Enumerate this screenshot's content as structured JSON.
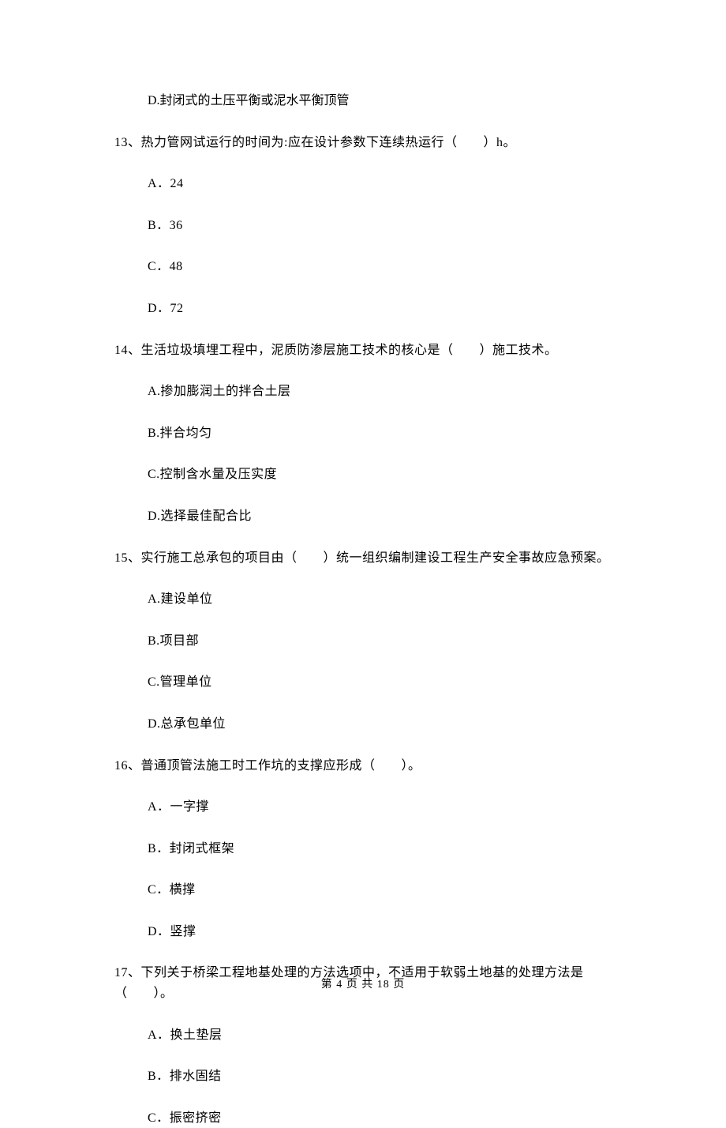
{
  "orphan_option": "D.封闭式的土压平衡或泥水平衡顶管",
  "questions": [
    {
      "number": "13、",
      "text": "热力管网试运行的时间为:应在设计参数下连续热运行（　　）h。",
      "options": [
        "A．24",
        "B．36",
        "C．48",
        "D．72"
      ]
    },
    {
      "number": "14、",
      "text": "生活垃圾填埋工程中，泥质防渗层施工技术的核心是（　　）施工技术。",
      "options": [
        "A.掺加膨润土的拌合土层",
        "B.拌合均匀",
        "C.控制含水量及压实度",
        "D.选择最佳配合比"
      ]
    },
    {
      "number": "15、",
      "text": "实行施工总承包的项目由（　　）统一组织编制建设工程生产安全事故应急预案。",
      "options": [
        "A.建设单位",
        "B.项目部",
        "C.管理单位",
        "D.总承包单位"
      ]
    },
    {
      "number": "16、",
      "text": "普通顶管法施工时工作坑的支撑应形成（　　）。",
      "options": [
        "A．一字撑",
        "B．封闭式框架",
        "C．横撑",
        "D．竖撑"
      ]
    },
    {
      "number": "17、",
      "text": "下列关于桥梁工程地基处理的方法选项中，不适用于软弱土地基的处理方法是（　　）。",
      "options": [
        "A．换土垫层",
        "B．排水固结",
        "C．振密挤密"
      ]
    }
  ],
  "footer": "第 4 页 共 18 页"
}
